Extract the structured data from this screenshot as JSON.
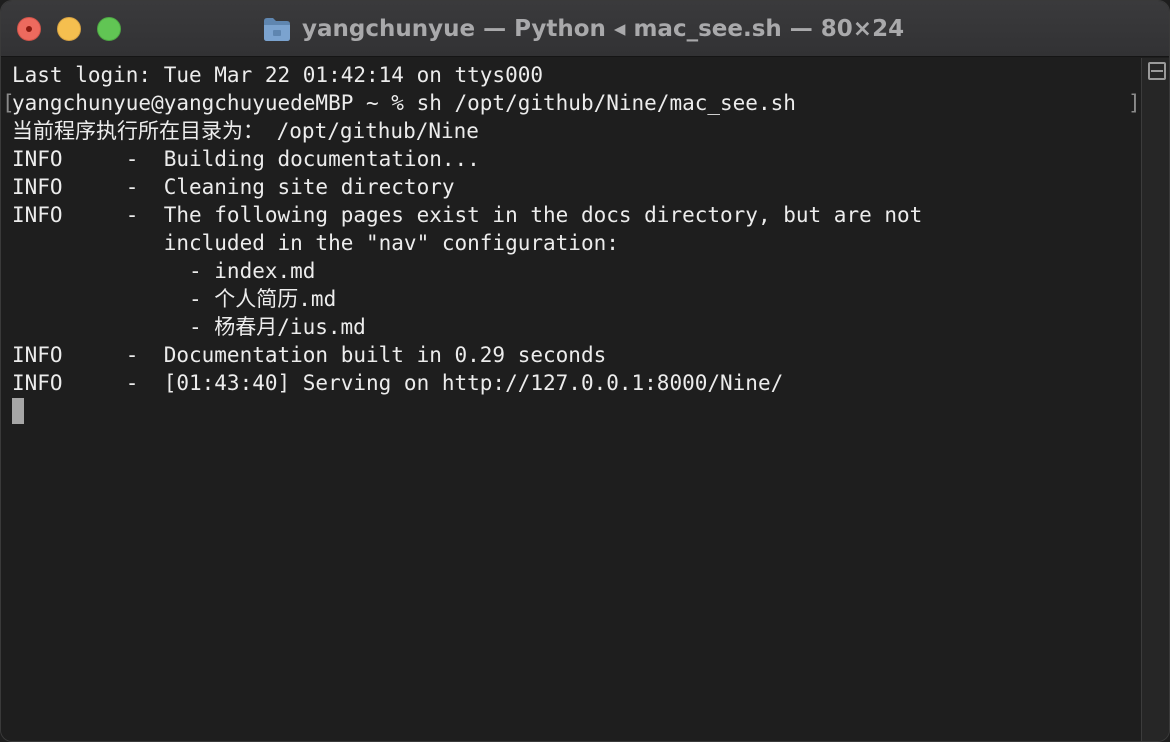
{
  "window": {
    "title": "yangchunyue — Python ◂ mac_see.sh — 80×24",
    "title_icon": "folder-icon",
    "colors": {
      "background": "#1e1e1e",
      "text": "#ececec",
      "close": "#ed6a5e",
      "minimize": "#f5bf4f",
      "maximize": "#61c554"
    }
  },
  "terminal": {
    "lines": [
      "Last login: Tue Mar 22 01:42:14 on ttys000",
      "yangchunyue@yangchuyuedeMBP ~ % sh /opt/github/Nine/mac_see.sh",
      "当前程序执行所在目录为： /opt/github/Nine",
      "INFO     -  Building documentation...",
      "INFO     -  Cleaning site directory",
      "INFO     -  The following pages exist in the docs directory, but are not",
      "            included in the \"nav\" configuration:",
      "              - index.md",
      "              - 个人简历.md",
      "              - 杨春月/ius.md",
      "INFO     -  Documentation built in 0.29 seconds",
      "INFO     -  [01:43:40] Serving on http://127.0.0.1:8000/Nine/"
    ],
    "mark_left": "[",
    "mark_right": "]"
  },
  "scrollbar": {
    "split_icon": "split-pane-icon"
  }
}
